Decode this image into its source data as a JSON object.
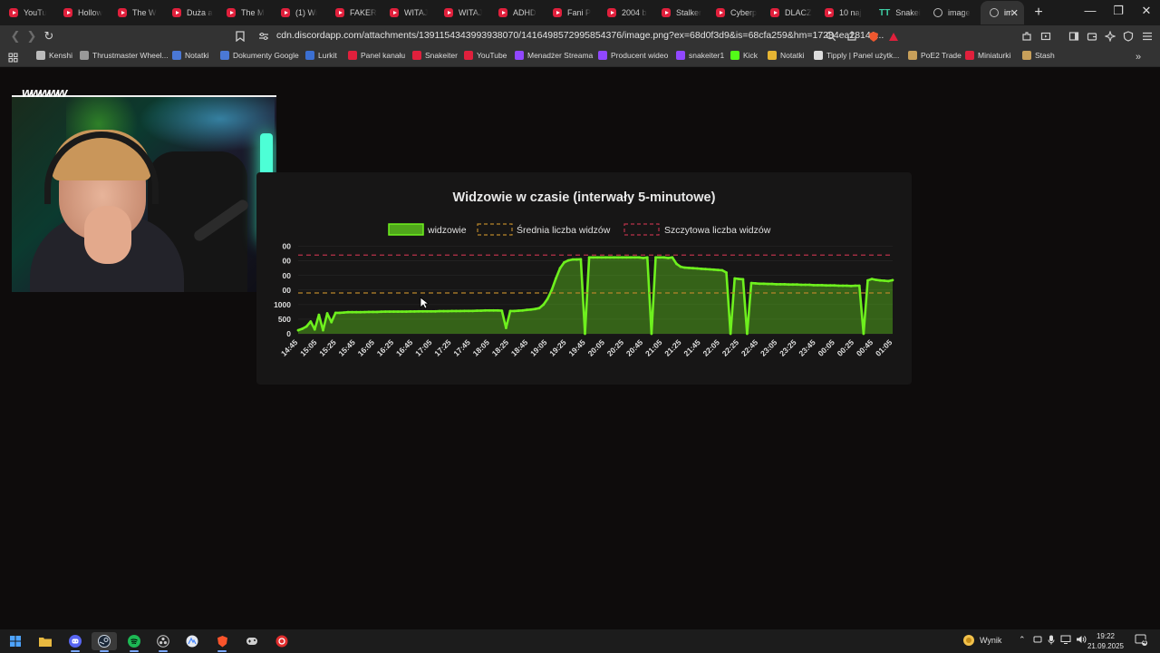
{
  "browser": {
    "tabs": [
      {
        "title": "YouTu",
        "icon": "youtube-icon"
      },
      {
        "title": "Hollow",
        "icon": "youtube-icon"
      },
      {
        "title": "The W",
        "icon": "youtube-icon"
      },
      {
        "title": "Duża a",
        "icon": "youtube-icon"
      },
      {
        "title": "The M",
        "icon": "youtube-icon"
      },
      {
        "title": "(1) Wi",
        "icon": "youtube-icon"
      },
      {
        "title": "FAKER",
        "icon": "youtube-icon"
      },
      {
        "title": "WITAJ",
        "icon": "youtube-icon"
      },
      {
        "title": "WITAJ",
        "icon": "youtube-icon"
      },
      {
        "title": "ADHD",
        "icon": "youtube-icon"
      },
      {
        "title": "Fani P",
        "icon": "youtube-icon"
      },
      {
        "title": "2004 b",
        "icon": "youtube-icon"
      },
      {
        "title": "Stalker",
        "icon": "youtube-icon"
      },
      {
        "title": "Cyberp",
        "icon": "youtube-icon"
      },
      {
        "title": "DLACZ",
        "icon": "youtube-icon"
      },
      {
        "title": "10 naj",
        "icon": "youtube-icon"
      },
      {
        "title": "Snakei",
        "icon": "tt-icon"
      },
      {
        "title": "image",
        "icon": "globe-icon"
      },
      {
        "title": "im",
        "icon": "globe-icon",
        "active": true
      }
    ],
    "url": "cdn.discordapp.com/attachments/1391154343993938070/1416498572995854376/image.png?ex=68d0f3d9&is=68cfa259&hm=17284ea28141...",
    "bookmarks": [
      {
        "label": "Kenshi",
        "color": "#bbbbbb"
      },
      {
        "label": "Thrustmaster Wheel...",
        "color": "#999999"
      },
      {
        "label": "Notatki",
        "color": "#4a78d6"
      },
      {
        "label": "Dokumenty Google",
        "color": "#4a78d6"
      },
      {
        "label": "Lurkit",
        "color": "#3b6fd1"
      },
      {
        "label": "Panel kanału",
        "color": "#e0203c"
      },
      {
        "label": "Snakeiter",
        "color": "#e0203c"
      },
      {
        "label": "YouTube",
        "color": "#e0203c"
      },
      {
        "label": "Menadżer Streama",
        "color": "#9147ff"
      },
      {
        "label": "Producent wideo",
        "color": "#9147ff"
      },
      {
        "label": "snakeiter1",
        "color": "#9147ff"
      },
      {
        "label": "Kick",
        "color": "#53fc18"
      },
      {
        "label": "Notatki",
        "color": "#e6b533"
      },
      {
        "label": "Tipply | Panel użytk...",
        "color": "#dddddd"
      },
      {
        "label": "PoE2 Trade",
        "color": "#c8a05a"
      },
      {
        "label": "Miniaturki",
        "color": "#e0203c"
      },
      {
        "label": "Stash",
        "color": "#c8a05a"
      }
    ]
  },
  "overlay": {
    "webcam_logo": "wwwww"
  },
  "chart_data": {
    "type": "area",
    "title": "Widzowie w czasie (interwały 5-minutowe)",
    "legend": [
      "widzowie",
      "Średnia liczba widzów",
      "Szczytowa liczba widzów"
    ],
    "legend_position": "top",
    "y_tick_labels": [
      "0",
      "500",
      "1000",
      "00",
      "00",
      "00",
      "00"
    ],
    "x_tick_labels": [
      "14:45",
      "15:05",
      "15:25",
      "15:45",
      "16:05",
      "16:25",
      "16:45",
      "17:05",
      "17:25",
      "17:45",
      "18:05",
      "18:25",
      "18:45",
      "19:05",
      "19:25",
      "19:45",
      "20:05",
      "20:25",
      "20:45",
      "21:05",
      "21:25",
      "21:45",
      "22:05",
      "22:25",
      "22:45",
      "23:05",
      "23:25",
      "23:45",
      "00:05",
      "00:25",
      "00:45",
      "01:05"
    ],
    "ylim": [
      0,
      3300
    ],
    "series_color": "#6ef01e",
    "average_line_value": 1400,
    "average_line_color": "#b8862a",
    "peak_line_value": 2700,
    "peak_line_color": "#b8324a",
    "values": [
      120,
      170,
      250,
      420,
      150,
      650,
      120,
      700,
      400,
      720,
      720,
      730,
      740,
      740,
      740,
      740,
      745,
      750,
      750,
      750,
      755,
      760,
      760,
      760,
      760,
      760,
      760,
      765,
      765,
      770,
      770,
      770,
      770,
      770,
      775,
      775,
      775,
      780,
      780,
      780,
      785,
      785,
      785,
      790,
      790,
      800,
      800,
      800,
      800,
      790,
      200,
      780,
      780,
      790,
      800,
      820,
      830,
      850,
      880,
      1000,
      1200,
      1500,
      1900,
      2250,
      2450,
      2520,
      2550,
      2550,
      2560,
      0,
      2620,
      2620,
      2620,
      2620,
      2620,
      2620,
      2620,
      2620,
      2620,
      2620,
      2620,
      2620,
      2620,
      2600,
      2620,
      0,
      2620,
      2620,
      2620,
      2600,
      2620,
      2400,
      2300,
      2270,
      2260,
      2250,
      2240,
      2230,
      2220,
      2210,
      2200,
      2190,
      2180,
      2100,
      0,
      1900,
      1880,
      1870,
      0,
      1740,
      1730,
      1720,
      1720,
      1710,
      1710,
      1700,
      1700,
      1700,
      1690,
      1690,
      1690,
      1680,
      1680,
      1680,
      1670,
      1670,
      1670,
      1660,
      1660,
      1660,
      1650,
      1650,
      1650,
      1640,
      1650,
      1650,
      0,
      1830,
      1880,
      1850,
      1830,
      1820,
      1810,
      1840
    ]
  },
  "taskbar": {
    "weather_label": "Wynik",
    "time": "19:22",
    "date": "21.09.2025",
    "notification_count": "4"
  }
}
